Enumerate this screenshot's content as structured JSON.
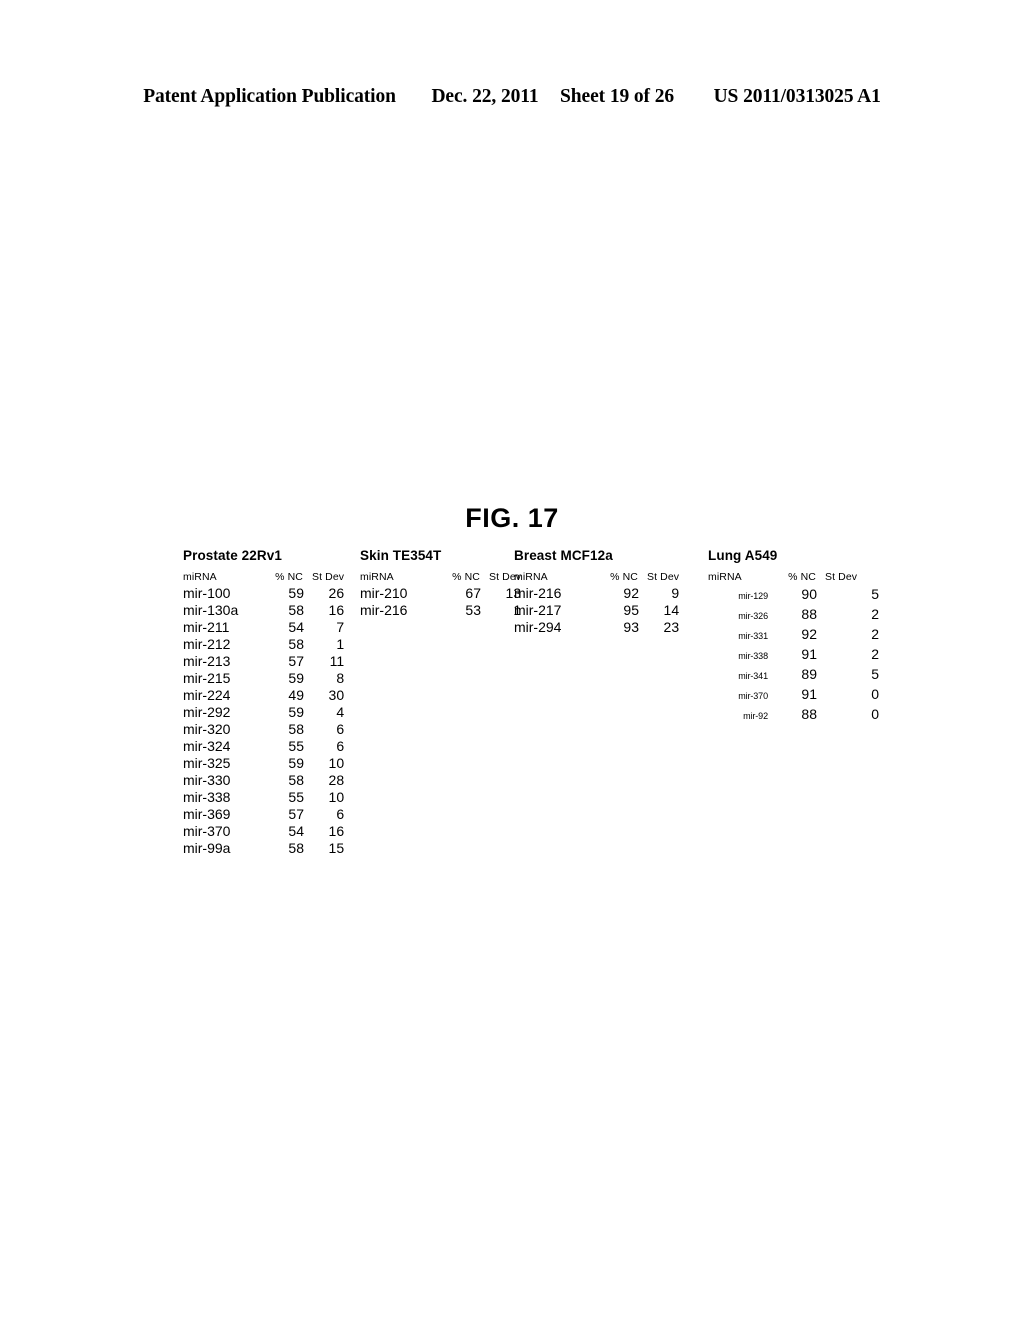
{
  "page_header": {
    "publication": "Patent Application Publication",
    "date": "Dec. 22, 2011",
    "sheet": "Sheet 19 of 26",
    "patent_number": "US 2011/0313025 A1"
  },
  "figure": {
    "title": "FIG. 17"
  },
  "columns": {
    "mirna": "miRNA",
    "pct_nc": "% NC",
    "st_dev": "St Dev"
  },
  "chart_data": {
    "type": "table",
    "title": "FIG. 17",
    "panels": [
      {
        "title": "Prostate 22Rv1",
        "columns": [
          "miRNA",
          "% NC",
          "St Dev"
        ],
        "rows": [
          [
            "mir-100",
            "59",
            "26"
          ],
          [
            "mir-130a",
            "58",
            "16"
          ],
          [
            "mir-211",
            "54",
            "7"
          ],
          [
            "mir-212",
            "58",
            "1"
          ],
          [
            "mir-213",
            "57",
            "11"
          ],
          [
            "mir-215",
            "59",
            "8"
          ],
          [
            "mir-224",
            "49",
            "30"
          ],
          [
            "mir-292",
            "59",
            "4"
          ],
          [
            "mir-320",
            "58",
            "6"
          ],
          [
            "mir-324",
            "55",
            "6"
          ],
          [
            "mir-325",
            "59",
            "10"
          ],
          [
            "mir-330",
            "58",
            "28"
          ],
          [
            "mir-338",
            "55",
            "10"
          ],
          [
            "mir-369",
            "57",
            "6"
          ],
          [
            "mir-370",
            "54",
            "16"
          ],
          [
            "mir-99a",
            "58",
            "15"
          ]
        ]
      },
      {
        "title": "Skin TE354T",
        "columns": [
          "miRNA",
          "% NC",
          "St Dev"
        ],
        "rows": [
          [
            "mir-210",
            "67",
            "13"
          ],
          [
            "mir-216",
            "53",
            "1"
          ]
        ]
      },
      {
        "title": "Breast MCF12a",
        "columns": [
          "miRNA",
          "% NC",
          "St Dev"
        ],
        "rows": [
          [
            "mir-216",
            "92",
            "9"
          ],
          [
            "mir-217",
            "95",
            "14"
          ],
          [
            "mir-294",
            "93",
            "23"
          ]
        ]
      },
      {
        "title": "Lung A549",
        "columns": [
          "miRNA",
          "% NC",
          "St Dev"
        ],
        "rows": [
          [
            "mir-129",
            "90",
            "5"
          ],
          [
            "mir-326",
            "88",
            "2"
          ],
          [
            "mir-331",
            "92",
            "2"
          ],
          [
            "mir-338",
            "91",
            "2"
          ],
          [
            "mir-341",
            "89",
            "5"
          ],
          [
            "mir-370",
            "91",
            "0"
          ],
          [
            "mir-92",
            "88",
            "0"
          ]
        ]
      }
    ]
  }
}
